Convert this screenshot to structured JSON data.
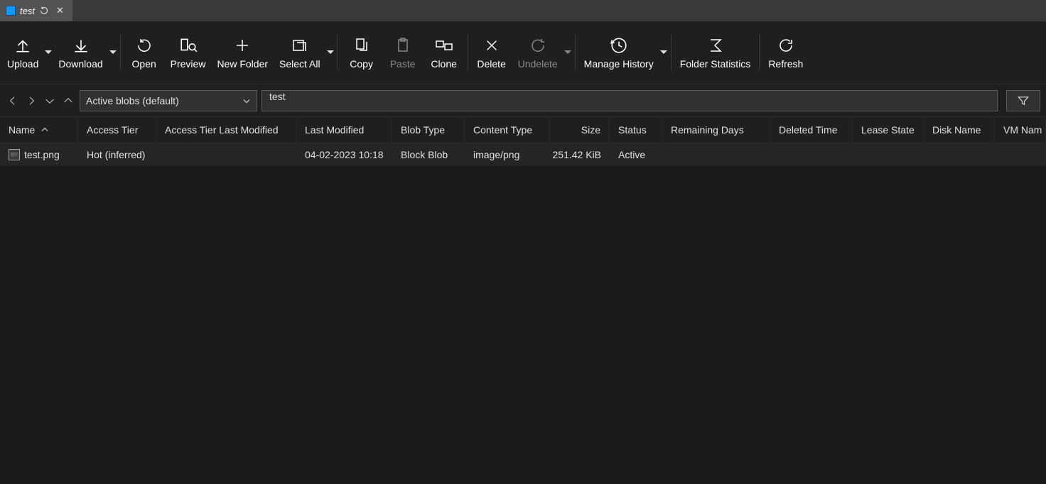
{
  "tab": {
    "title": "test"
  },
  "toolbar": {
    "upload": "Upload",
    "download": "Download",
    "open": "Open",
    "preview": "Preview",
    "new_folder": "New Folder",
    "select_all": "Select All",
    "copy": "Copy",
    "paste": "Paste",
    "clone": "Clone",
    "delete": "Delete",
    "undelete": "Undelete",
    "manage_history": "Manage History",
    "folder_stats": "Folder Statistics",
    "refresh": "Refresh"
  },
  "nav": {
    "view_mode": "Active blobs (default)",
    "breadcrumb": "test"
  },
  "columns": {
    "name": "Name",
    "tier": "Access Tier",
    "tier_lm": "Access Tier Last Modified",
    "lm": "Last Modified",
    "btype": "Blob Type",
    "ctype": "Content Type",
    "size": "Size",
    "status": "Status",
    "rem": "Remaining Days",
    "del": "Deleted Time",
    "lease": "Lease State",
    "disk": "Disk Name",
    "vm": "VM Nam"
  },
  "rows": [
    {
      "name": "test.png",
      "tier": "Hot (inferred)",
      "tier_lm": "",
      "lm": "04-02-2023 10:18",
      "btype": "Block Blob",
      "ctype": "image/png",
      "size": "251.42 KiB",
      "status": "Active",
      "rem": "",
      "del": "",
      "lease": "",
      "disk": "",
      "vm": ""
    }
  ]
}
